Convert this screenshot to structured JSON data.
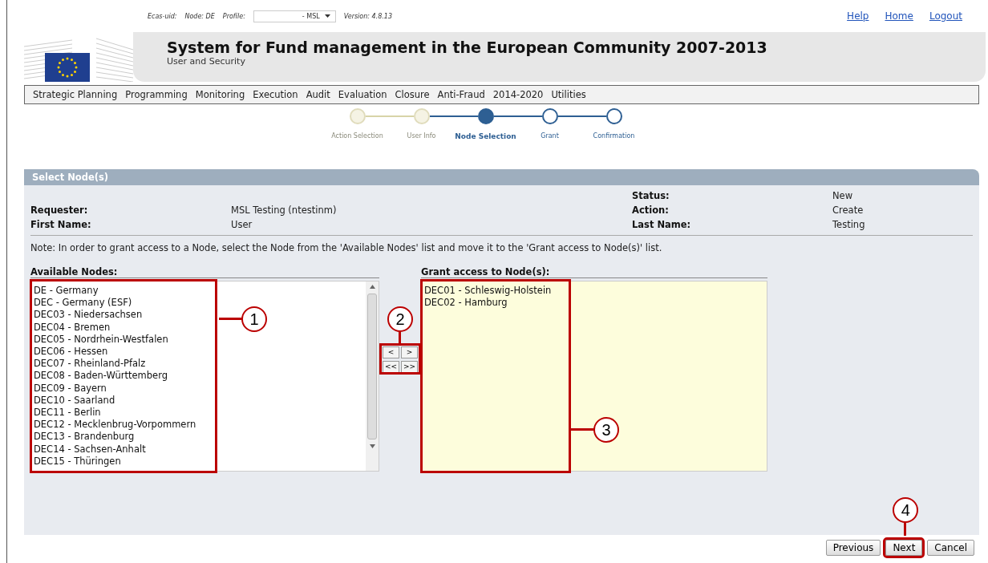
{
  "top_bar": {
    "ecas_label": "Ecas-uid:",
    "node_label": "Node: DE",
    "profile_label": "Profile:",
    "profile_value": "- MSL",
    "version": "Version: 4.8.13",
    "links": [
      "Help",
      "Home",
      "Logout"
    ]
  },
  "banner": {
    "title": "System for Fund management in the European Community 2007-2013",
    "subtitle": "User and Security"
  },
  "menu": [
    "Strategic Planning",
    "Programming",
    "Monitoring",
    "Execution",
    "Audit",
    "Evaluation",
    "Closure",
    "Anti-Fraud",
    "2014-2020",
    "Utilities"
  ],
  "steps": [
    {
      "label": "Action Selection",
      "done": true,
      "selected": false
    },
    {
      "label": "User Info",
      "done": true,
      "selected": false
    },
    {
      "label": "Node Selection",
      "done": false,
      "selected": true
    },
    {
      "label": "Grant",
      "done": false,
      "selected": false
    },
    {
      "label": "Confirmation",
      "done": false,
      "selected": false
    }
  ],
  "panel": {
    "title": "Select Node(s)",
    "fields_left": [
      {
        "label": "Requester:",
        "value": "MSL Testing (ntestinm)"
      },
      {
        "label": "First Name:",
        "value": "User"
      }
    ],
    "fields_right": [
      {
        "label": "Status:",
        "value": "New"
      },
      {
        "label": "Action:",
        "value": "Create"
      },
      {
        "label": "Last Name:",
        "value": "Testing"
      }
    ],
    "note": "Note: In order to grant access to a Node, select the Node from the 'Available Nodes' list and move it to the 'Grant access to Node(s)' list.",
    "available": {
      "label": "Available Nodes:",
      "items": [
        "DE - Germany",
        "DEC - Germany (ESF)",
        "DEC03 - Niedersachsen",
        "DEC04 - Bremen",
        "DEC05 - Nordrhein-Westfalen",
        "DEC06 - Hessen",
        "DEC07 - Rheinland-Pfalz",
        "DEC08 - Baden-Württemberg",
        "DEC09 - Bayern",
        "DEC10 - Saarland",
        "DEC11 - Berlin",
        "DEC12 - Mecklenbrug-Vorpommern",
        "DEC13 - Brandenburg",
        "DEC14 - Sachsen-Anhalt",
        "DEC15 - Thüringen"
      ]
    },
    "move_buttons": [
      "<",
      ">",
      "<<",
      ">>"
    ],
    "granted": {
      "label": "Grant access to Node(s):",
      "items": [
        "DEC01 - Schleswig-Holstein",
        "DEC02 - Hamburg"
      ]
    }
  },
  "buttons": [
    {
      "label": "Previous",
      "highlighted": false
    },
    {
      "label": "Next",
      "highlighted": true
    },
    {
      "label": "Cancel",
      "highlighted": false
    }
  ],
  "callouts": [
    "1",
    "2",
    "3",
    "4"
  ]
}
